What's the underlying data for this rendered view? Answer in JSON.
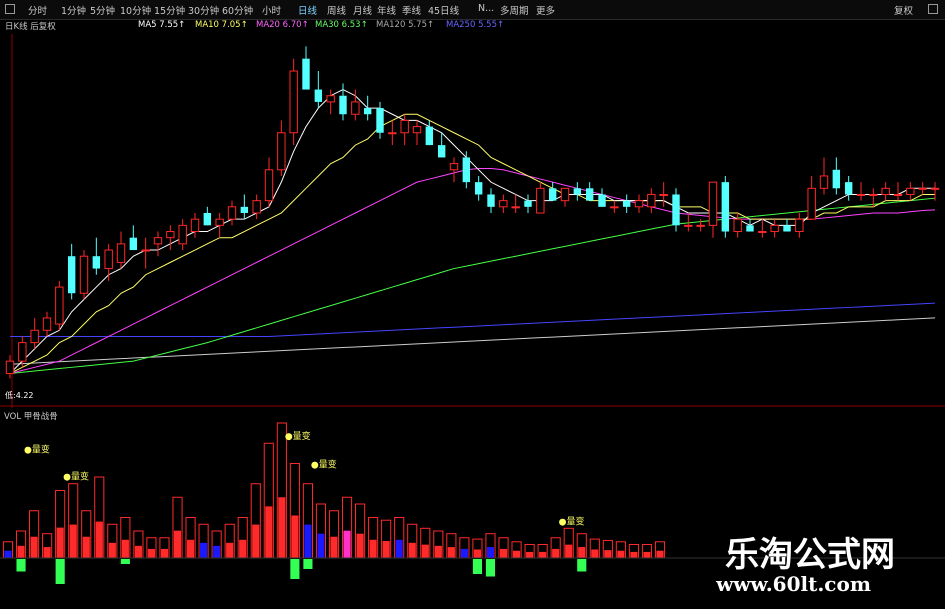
{
  "toolbar": {
    "items": [
      {
        "id": "tf-fenshi",
        "label": "分时"
      },
      {
        "id": "tf-1m",
        "label": "1分钟"
      },
      {
        "id": "tf-5m",
        "label": "5分钟"
      },
      {
        "id": "tf-10m",
        "label": "10分钟"
      },
      {
        "id": "tf-15m",
        "label": "15分钟"
      },
      {
        "id": "tf-30m",
        "label": "30分钟"
      },
      {
        "id": "tf-60m",
        "label": "60分钟"
      },
      {
        "id": "tf-hour",
        "label": "小时"
      },
      {
        "id": "tf-day",
        "label": "日线",
        "active": true
      },
      {
        "id": "tf-week",
        "label": "周线"
      },
      {
        "id": "tf-month",
        "label": "月线"
      },
      {
        "id": "tf-year",
        "label": "年线"
      },
      {
        "id": "tf-quarter",
        "label": "季线"
      },
      {
        "id": "tf-45day",
        "label": "45日线"
      },
      {
        "id": "tf-n",
        "label": "N..."
      },
      {
        "id": "tf-multi",
        "label": "多周期"
      },
      {
        "id": "tf-more",
        "label": "更多"
      }
    ],
    "right_label": "复权"
  },
  "ma_bar": {
    "prefix": "日K线 后复权",
    "items": [
      {
        "label": "MA5",
        "value": "7.55",
        "color": "#ffffff"
      },
      {
        "label": "MA10",
        "value": "7.05",
        "color": "#ffff66"
      },
      {
        "label": "MA20",
        "value": "6.70",
        "color": "#ff66ff"
      },
      {
        "label": "MA30",
        "value": "6.53",
        "color": "#66ff66"
      },
      {
        "label": "MA120",
        "value": "5.75",
        "color": "#aaaaaa"
      },
      {
        "label": "MA250",
        "value": "5.55",
        "color": "#6666ff"
      }
    ]
  },
  "price_low_label": "低:4.22",
  "sub_chart": {
    "header": "VOL 甲骨战骨"
  },
  "annotations": [
    "量变",
    "量变",
    "量变",
    "量变",
    "量变"
  ],
  "colors": {
    "up": "#ff2828",
    "down": "#54ffff",
    "ma5": "#ffffff",
    "ma10": "#ffff66",
    "ma20": "#ff44ff",
    "ma30": "#44ff44",
    "ma250": "#4444ff",
    "grid": "#8b0000"
  },
  "chart_data": {
    "type": "candlestick",
    "title": "",
    "candles": [
      {
        "o": 4.3,
        "h": 4.6,
        "l": 4.22,
        "c": 4.5
      },
      {
        "o": 4.5,
        "h": 4.9,
        "l": 4.4,
        "c": 4.8
      },
      {
        "o": 4.8,
        "h": 5.2,
        "l": 4.7,
        "c": 5.0
      },
      {
        "o": 5.0,
        "h": 5.3,
        "l": 4.9,
        "c": 5.2
      },
      {
        "o": 5.1,
        "h": 5.8,
        "l": 5.0,
        "c": 5.7
      },
      {
        "o": 6.2,
        "h": 6.4,
        "l": 5.5,
        "c": 5.6
      },
      {
        "o": 5.6,
        "h": 6.3,
        "l": 5.5,
        "c": 6.2
      },
      {
        "o": 6.2,
        "h": 6.5,
        "l": 5.9,
        "c": 6.0
      },
      {
        "o": 6.0,
        "h": 6.4,
        "l": 5.8,
        "c": 6.3
      },
      {
        "o": 6.1,
        "h": 6.6,
        "l": 6.0,
        "c": 6.4
      },
      {
        "o": 6.5,
        "h": 6.7,
        "l": 6.3,
        "c": 6.3
      },
      {
        "o": 6.3,
        "h": 6.5,
        "l": 6.0,
        "c": 6.3
      },
      {
        "o": 6.4,
        "h": 6.6,
        "l": 6.2,
        "c": 6.5
      },
      {
        "o": 6.5,
        "h": 6.7,
        "l": 6.3,
        "c": 6.6
      },
      {
        "o": 6.4,
        "h": 6.8,
        "l": 6.3,
        "c": 6.7
      },
      {
        "o": 6.6,
        "h": 6.9,
        "l": 6.5,
        "c": 6.8
      },
      {
        "o": 6.9,
        "h": 7.0,
        "l": 6.7,
        "c": 6.7
      },
      {
        "o": 6.7,
        "h": 6.9,
        "l": 6.5,
        "c": 6.8
      },
      {
        "o": 6.8,
        "h": 7.1,
        "l": 6.7,
        "c": 7.0
      },
      {
        "o": 7.0,
        "h": 7.2,
        "l": 6.8,
        "c": 6.9
      },
      {
        "o": 6.9,
        "h": 7.2,
        "l": 6.8,
        "c": 7.1
      },
      {
        "o": 7.1,
        "h": 7.8,
        "l": 7.0,
        "c": 7.6
      },
      {
        "o": 7.6,
        "h": 8.4,
        "l": 7.5,
        "c": 8.2
      },
      {
        "o": 8.2,
        "h": 9.4,
        "l": 8.0,
        "c": 9.2
      },
      {
        "o": 9.4,
        "h": 9.6,
        "l": 8.9,
        "c": 8.9
      },
      {
        "o": 8.9,
        "h": 9.2,
        "l": 8.6,
        "c": 8.7
      },
      {
        "o": 8.7,
        "h": 8.9,
        "l": 8.5,
        "c": 8.8
      },
      {
        "o": 8.8,
        "h": 9.0,
        "l": 8.4,
        "c": 8.5
      },
      {
        "o": 8.5,
        "h": 8.9,
        "l": 8.4,
        "c": 8.7
      },
      {
        "o": 8.6,
        "h": 8.8,
        "l": 8.4,
        "c": 8.5
      },
      {
        "o": 8.6,
        "h": 8.7,
        "l": 8.1,
        "c": 8.2
      },
      {
        "o": 8.2,
        "h": 8.4,
        "l": 8.0,
        "c": 8.2
      },
      {
        "o": 8.2,
        "h": 8.5,
        "l": 8.0,
        "c": 8.4
      },
      {
        "o": 8.2,
        "h": 8.4,
        "l": 8.0,
        "c": 8.3
      },
      {
        "o": 8.3,
        "h": 8.4,
        "l": 8.0,
        "c": 8.0
      },
      {
        "o": 8.0,
        "h": 8.2,
        "l": 7.8,
        "c": 7.8
      },
      {
        "o": 7.6,
        "h": 7.8,
        "l": 7.4,
        "c": 7.7
      },
      {
        "o": 7.8,
        "h": 7.9,
        "l": 7.3,
        "c": 7.4
      },
      {
        "o": 7.4,
        "h": 7.5,
        "l": 7.1,
        "c": 7.2
      },
      {
        "o": 7.2,
        "h": 7.3,
        "l": 6.9,
        "c": 7.0
      },
      {
        "o": 7.0,
        "h": 7.2,
        "l": 6.9,
        "c": 7.1
      },
      {
        "o": 7.0,
        "h": 7.2,
        "l": 6.9,
        "c": 7.0
      },
      {
        "o": 7.1,
        "h": 7.2,
        "l": 6.9,
        "c": 7.0
      },
      {
        "o": 6.9,
        "h": 7.4,
        "l": 6.9,
        "c": 7.3
      },
      {
        "o": 7.3,
        "h": 7.4,
        "l": 7.1,
        "c": 7.1
      },
      {
        "o": 7.1,
        "h": 7.3,
        "l": 7.0,
        "c": 7.3
      },
      {
        "o": 7.3,
        "h": 7.4,
        "l": 7.1,
        "c": 7.2
      },
      {
        "o": 7.3,
        "h": 7.4,
        "l": 7.1,
        "c": 7.1
      },
      {
        "o": 7.2,
        "h": 7.3,
        "l": 7.0,
        "c": 7.0
      },
      {
        "o": 7.0,
        "h": 7.1,
        "l": 6.9,
        "c": 7.0
      },
      {
        "o": 7.1,
        "h": 7.2,
        "l": 6.9,
        "c": 7.0
      },
      {
        "o": 7.0,
        "h": 7.2,
        "l": 6.9,
        "c": 7.1
      },
      {
        "o": 7.0,
        "h": 7.3,
        "l": 6.9,
        "c": 7.2
      },
      {
        "o": 7.2,
        "h": 7.4,
        "l": 7.0,
        "c": 7.2
      },
      {
        "o": 7.2,
        "h": 7.3,
        "l": 6.6,
        "c": 6.7
      },
      {
        "o": 6.7,
        "h": 6.9,
        "l": 6.6,
        "c": 6.7
      },
      {
        "o": 6.7,
        "h": 6.8,
        "l": 6.6,
        "c": 6.7
      },
      {
        "o": 6.7,
        "h": 7.4,
        "l": 6.5,
        "c": 7.4
      },
      {
        "o": 7.4,
        "h": 7.5,
        "l": 6.5,
        "c": 6.6
      },
      {
        "o": 6.6,
        "h": 6.9,
        "l": 6.5,
        "c": 6.8
      },
      {
        "o": 6.7,
        "h": 6.8,
        "l": 6.6,
        "c": 6.6
      },
      {
        "o": 6.6,
        "h": 6.8,
        "l": 6.5,
        "c": 6.6
      },
      {
        "o": 6.6,
        "h": 6.8,
        "l": 6.5,
        "c": 6.7
      },
      {
        "o": 6.7,
        "h": 6.8,
        "l": 6.6,
        "c": 6.6
      },
      {
        "o": 6.6,
        "h": 6.9,
        "l": 6.5,
        "c": 6.8
      },
      {
        "o": 6.8,
        "h": 7.5,
        "l": 6.8,
        "c": 7.3
      },
      {
        "o": 7.3,
        "h": 7.8,
        "l": 7.2,
        "c": 7.5
      },
      {
        "o": 7.6,
        "h": 7.8,
        "l": 7.2,
        "c": 7.3
      },
      {
        "o": 7.4,
        "h": 7.5,
        "l": 7.1,
        "c": 7.2
      },
      {
        "o": 7.2,
        "h": 7.4,
        "l": 7.1,
        "c": 7.2
      },
      {
        "o": 7.2,
        "h": 7.3,
        "l": 7.0,
        "c": 7.2
      },
      {
        "o": 7.2,
        "h": 7.4,
        "l": 7.1,
        "c": 7.3
      },
      {
        "o": 7.2,
        "h": 7.4,
        "l": 7.1,
        "c": 7.2
      },
      {
        "o": 7.2,
        "h": 7.4,
        "l": 7.1,
        "c": 7.3
      },
      {
        "o": 7.3,
        "h": 7.4,
        "l": 7.2,
        "c": 7.3
      },
      {
        "o": 7.3,
        "h": 7.4,
        "l": 7.1,
        "c": 7.3
      }
    ],
    "ma5": [
      4.3,
      4.5,
      4.7,
      4.9,
      5.0,
      5.3,
      5.5,
      5.7,
      5.9,
      6.0,
      6.2,
      6.3,
      6.3,
      6.4,
      6.5,
      6.6,
      6.6,
      6.7,
      6.8,
      6.8,
      6.9,
      7.0,
      7.4,
      7.9,
      8.3,
      8.6,
      8.8,
      8.9,
      8.8,
      8.6,
      8.6,
      8.5,
      8.4,
      8.4,
      8.3,
      8.2,
      8.0,
      7.8,
      7.6,
      7.4,
      7.3,
      7.2,
      7.1,
      7.1,
      7.1,
      7.2,
      7.2,
      7.2,
      7.2,
      7.1,
      7.1,
      7.1,
      7.1,
      7.1,
      7.0,
      6.9,
      6.9,
      6.9,
      6.9,
      6.8,
      6.7,
      6.8,
      6.7,
      6.7,
      6.7,
      6.9,
      7.0,
      7.1,
      7.2,
      7.2,
      7.2,
      7.2,
      7.2,
      7.3,
      7.3,
      7.3
    ],
    "ma10": [
      4.3,
      4.4,
      4.5,
      4.6,
      4.8,
      4.9,
      5.1,
      5.3,
      5.4,
      5.6,
      5.7,
      5.9,
      6.0,
      6.1,
      6.2,
      6.3,
      6.4,
      6.5,
      6.5,
      6.6,
      6.7,
      6.8,
      6.9,
      7.1,
      7.3,
      7.5,
      7.7,
      7.8,
      8.0,
      8.1,
      8.3,
      8.4,
      8.5,
      8.5,
      8.4,
      8.3,
      8.2,
      8.1,
      8.0,
      7.8,
      7.7,
      7.6,
      7.5,
      7.4,
      7.3,
      7.2,
      7.2,
      7.1,
      7.1,
      7.1,
      7.1,
      7.1,
      7.1,
      7.1,
      7.0,
      7.0,
      7.0,
      6.9,
      6.9,
      6.9,
      6.8,
      6.8,
      6.8,
      6.8,
      6.8,
      6.8,
      6.9,
      6.9,
      7.0,
      7.0,
      7.0,
      7.1,
      7.1,
      7.1,
      7.2,
      7.2
    ],
    "ma20": [
      4.3,
      4.35,
      4.4,
      4.45,
      4.5,
      4.6,
      4.7,
      4.8,
      4.9,
      5.0,
      5.1,
      5.2,
      5.3,
      5.4,
      5.5,
      5.6,
      5.7,
      5.8,
      5.9,
      6.0,
      6.1,
      6.2,
      6.3,
      6.4,
      6.5,
      6.6,
      6.7,
      6.8,
      6.9,
      7.0,
      7.1,
      7.2,
      7.3,
      7.4,
      7.45,
      7.5,
      7.55,
      7.6,
      7.62,
      7.62,
      7.6,
      7.55,
      7.5,
      7.45,
      7.4,
      7.35,
      7.3,
      7.25,
      7.2,
      7.15,
      7.1,
      7.05,
      7.0,
      6.95,
      6.9,
      6.88,
      6.86,
      6.84,
      6.82,
      6.8,
      6.8,
      6.8,
      6.8,
      6.8,
      6.8,
      6.8,
      6.82,
      6.84,
      6.86,
      6.88,
      6.9,
      6.9,
      6.9,
      6.92,
      6.94,
      6.95
    ],
    "ma30": [
      4.3,
      4.32,
      4.34,
      4.36,
      4.38,
      4.4,
      4.42,
      4.44,
      4.46,
      4.48,
      4.5,
      4.55,
      4.6,
      4.65,
      4.7,
      4.75,
      4.8,
      4.86,
      4.92,
      4.98,
      5.04,
      5.1,
      5.16,
      5.22,
      5.28,
      5.34,
      5.4,
      5.46,
      5.52,
      5.58,
      5.64,
      5.7,
      5.76,
      5.82,
      5.88,
      5.94,
      6.0,
      6.04,
      6.08,
      6.12,
      6.16,
      6.2,
      6.24,
      6.28,
      6.32,
      6.36,
      6.4,
      6.44,
      6.48,
      6.52,
      6.56,
      6.6,
      6.64,
      6.68,
      6.72,
      6.74,
      6.76,
      6.78,
      6.8,
      6.82,
      6.84,
      6.86,
      6.88,
      6.9,
      6.92,
      6.94,
      6.96,
      6.98,
      7.0,
      7.02,
      7.04,
      7.06,
      7.08,
      7.1,
      7.12,
      7.14
    ],
    "ma120": [
      4.45,
      4.46,
      4.47,
      4.48,
      4.49,
      4.5,
      4.51,
      4.52,
      4.53,
      4.54,
      4.55,
      4.56,
      4.57,
      4.58,
      4.59,
      4.6,
      4.61,
      4.62,
      4.63,
      4.64,
      4.65,
      4.66,
      4.67,
      4.68,
      4.69,
      4.7,
      4.71,
      4.72,
      4.73,
      4.74,
      4.75,
      4.76,
      4.77,
      4.78,
      4.79,
      4.8,
      4.81,
      4.82,
      4.83,
      4.84,
      4.85,
      4.86,
      4.87,
      4.88,
      4.89,
      4.9,
      4.91,
      4.92,
      4.93,
      4.94,
      4.95,
      4.96,
      4.97,
      4.98,
      4.99,
      5.0,
      5.01,
      5.02,
      5.03,
      5.04,
      5.05,
      5.06,
      5.07,
      5.08,
      5.09,
      5.1,
      5.11,
      5.12,
      5.13,
      5.14,
      5.15,
      5.16,
      5.17,
      5.18,
      5.19,
      5.2
    ],
    "ma250": [
      4.9,
      4.9,
      4.9,
      4.9,
      4.9,
      4.9,
      4.9,
      4.9,
      4.9,
      4.9,
      4.9,
      4.9,
      4.9,
      4.9,
      4.9,
      4.9,
      4.9,
      4.9,
      4.9,
      4.9,
      4.9,
      4.9,
      4.91,
      4.92,
      4.93,
      4.94,
      4.95,
      4.96,
      4.97,
      4.98,
      4.99,
      5.0,
      5.01,
      5.02,
      5.03,
      5.04,
      5.05,
      5.06,
      5.07,
      5.08,
      5.09,
      5.1,
      5.11,
      5.12,
      5.13,
      5.14,
      5.15,
      5.16,
      5.17,
      5.18,
      5.19,
      5.2,
      5.21,
      5.22,
      5.23,
      5.24,
      5.25,
      5.26,
      5.27,
      5.28,
      5.29,
      5.3,
      5.31,
      5.32,
      5.33,
      5.34,
      5.35,
      5.36,
      5.37,
      5.38,
      5.39,
      5.4,
      5.41,
      5.42,
      5.43,
      5.44
    ],
    "ylim": [
      4.0,
      9.8
    ],
    "volume": [
      {
        "v": 0.12,
        "d": 0.0,
        "c": "b"
      },
      {
        "v": 0.2,
        "d": 0.25,
        "c": "r"
      },
      {
        "v": 0.35,
        "d": 0.0,
        "c": "r"
      },
      {
        "v": 0.18,
        "d": 0.0,
        "c": "r"
      },
      {
        "v": 0.5,
        "d": 0.5,
        "c": "r"
      },
      {
        "v": 0.55,
        "d": 0.0,
        "c": "r"
      },
      {
        "v": 0.35,
        "d": 0.0,
        "c": "r"
      },
      {
        "v": 0.6,
        "d": 0.0,
        "c": "r"
      },
      {
        "v": 0.25,
        "d": 0.0,
        "c": "r"
      },
      {
        "v": 0.3,
        "d": 0.1,
        "c": "r"
      },
      {
        "v": 0.2,
        "d": 0.0,
        "c": "r"
      },
      {
        "v": 0.15,
        "d": 0.0,
        "c": "r"
      },
      {
        "v": 0.15,
        "d": 0.0,
        "c": "r"
      },
      {
        "v": 0.45,
        "d": 0.0,
        "c": "r"
      },
      {
        "v": 0.3,
        "d": 0.0,
        "c": "r"
      },
      {
        "v": 0.25,
        "d": 0.0,
        "c": "b"
      },
      {
        "v": 0.2,
        "d": 0.0,
        "c": "b"
      },
      {
        "v": 0.25,
        "d": 0.0,
        "c": "r"
      },
      {
        "v": 0.3,
        "d": 0.0,
        "c": "r"
      },
      {
        "v": 0.55,
        "d": 0.0,
        "c": "r"
      },
      {
        "v": 0.85,
        "d": 0.0,
        "c": "r"
      },
      {
        "v": 1.0,
        "d": 0.0,
        "c": "r"
      },
      {
        "v": 0.7,
        "d": 0.4,
        "c": "r"
      },
      {
        "v": 0.55,
        "d": 0.2,
        "c": "b"
      },
      {
        "v": 0.4,
        "d": 0.0,
        "c": "b"
      },
      {
        "v": 0.35,
        "d": 0.0,
        "c": "r"
      },
      {
        "v": 0.45,
        "d": 0.0,
        "c": "p"
      },
      {
        "v": 0.4,
        "d": 0.0,
        "c": "r"
      },
      {
        "v": 0.3,
        "d": 0.0,
        "c": "r"
      },
      {
        "v": 0.28,
        "d": 0.0,
        "c": "r"
      },
      {
        "v": 0.3,
        "d": 0.0,
        "c": "b"
      },
      {
        "v": 0.25,
        "d": 0.0,
        "c": "r"
      },
      {
        "v": 0.22,
        "d": 0.0,
        "c": "r"
      },
      {
        "v": 0.2,
        "d": 0.0,
        "c": "r"
      },
      {
        "v": 0.18,
        "d": 0.0,
        "c": "r"
      },
      {
        "v": 0.15,
        "d": 0.0,
        "c": "b"
      },
      {
        "v": 0.14,
        "d": 0.3,
        "c": "r"
      },
      {
        "v": 0.18,
        "d": 0.35,
        "c": "b"
      },
      {
        "v": 0.15,
        "d": 0.0,
        "c": "r"
      },
      {
        "v": 0.12,
        "d": 0.0,
        "c": "r"
      },
      {
        "v": 0.1,
        "d": 0.0,
        "c": "r"
      },
      {
        "v": 0.1,
        "d": 0.0,
        "c": "r"
      },
      {
        "v": 0.15,
        "d": 0.0,
        "c": "r"
      },
      {
        "v": 0.22,
        "d": 0.0,
        "c": "r"
      },
      {
        "v": 0.18,
        "d": 0.25,
        "c": "r"
      },
      {
        "v": 0.14,
        "d": 0.0,
        "c": "r"
      },
      {
        "v": 0.13,
        "d": 0.0,
        "c": "r"
      },
      {
        "v": 0.12,
        "d": 0.0,
        "c": "r"
      },
      {
        "v": 0.1,
        "d": 0.0,
        "c": "r"
      },
      {
        "v": 0.1,
        "d": 0.0,
        "c": "r"
      },
      {
        "v": 0.12,
        "d": 0.0,
        "c": "r"
      }
    ]
  }
}
